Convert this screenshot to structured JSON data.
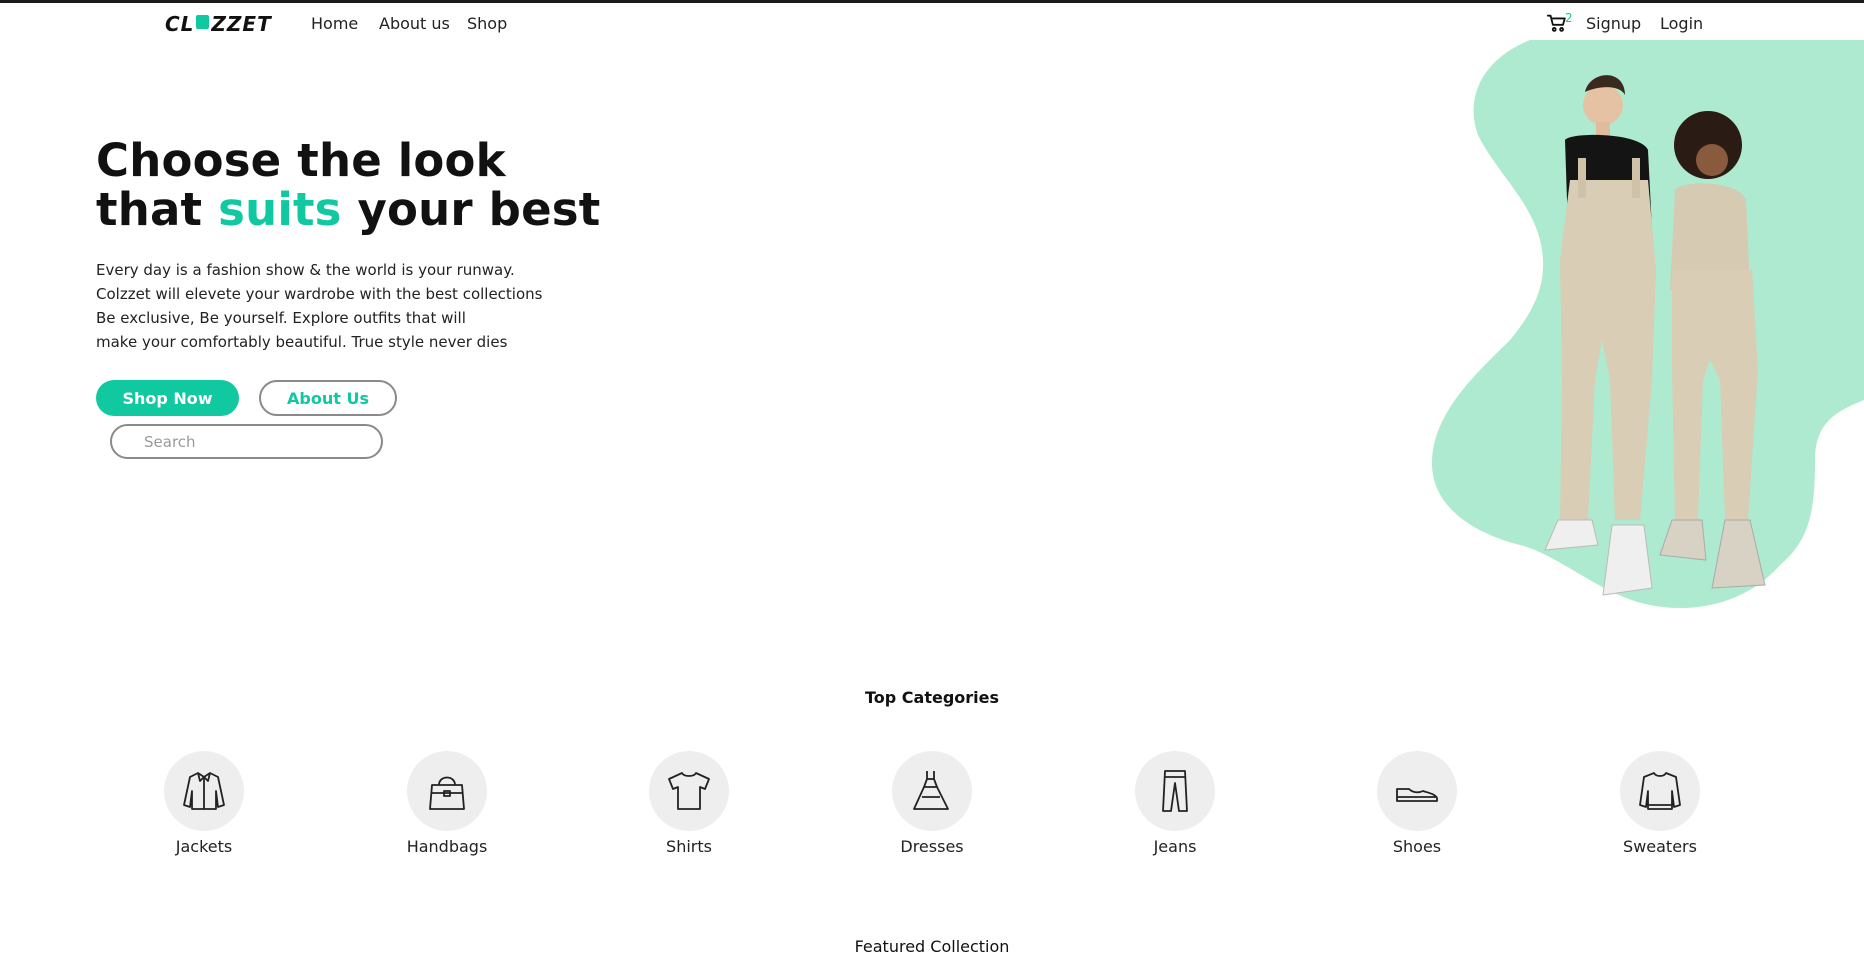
{
  "brand": {
    "logo_left": "CL",
    "logo_right": "ZZET",
    "accent": "#10c9a1"
  },
  "nav": {
    "links": [
      "Home",
      "About us",
      "Shop"
    ],
    "cart_count": "2",
    "signup": "Signup",
    "login": "Login"
  },
  "hero": {
    "title_line1": "Choose the look",
    "title_pre": "that ",
    "title_accent": "suits",
    "title_post": " your best",
    "paragraph": [
      "Every day is a fashion show & the world is your runway.",
      "Colzzet will elevete your wardrobe with the best collections",
      "Be exclusive, Be yourself. Explore outfits that will",
      "make your comfortably beautiful. True style never dies"
    ],
    "shop_now": "Shop Now",
    "about_us": "About Us",
    "search_placeholder": "Search"
  },
  "categories": {
    "title": "Top Categories",
    "items": [
      {
        "label": "Jackets",
        "icon": "jacket-icon"
      },
      {
        "label": "Handbags",
        "icon": "handbag-icon"
      },
      {
        "label": "Shirts",
        "icon": "shirt-icon"
      },
      {
        "label": "Dresses",
        "icon": "dress-icon"
      },
      {
        "label": "Jeans",
        "icon": "jeans-icon"
      },
      {
        "label": "Shoes",
        "icon": "shoe-icon"
      },
      {
        "label": "Sweaters",
        "icon": "sweater-icon"
      }
    ]
  },
  "featured": {
    "title": "Featured Collection"
  }
}
